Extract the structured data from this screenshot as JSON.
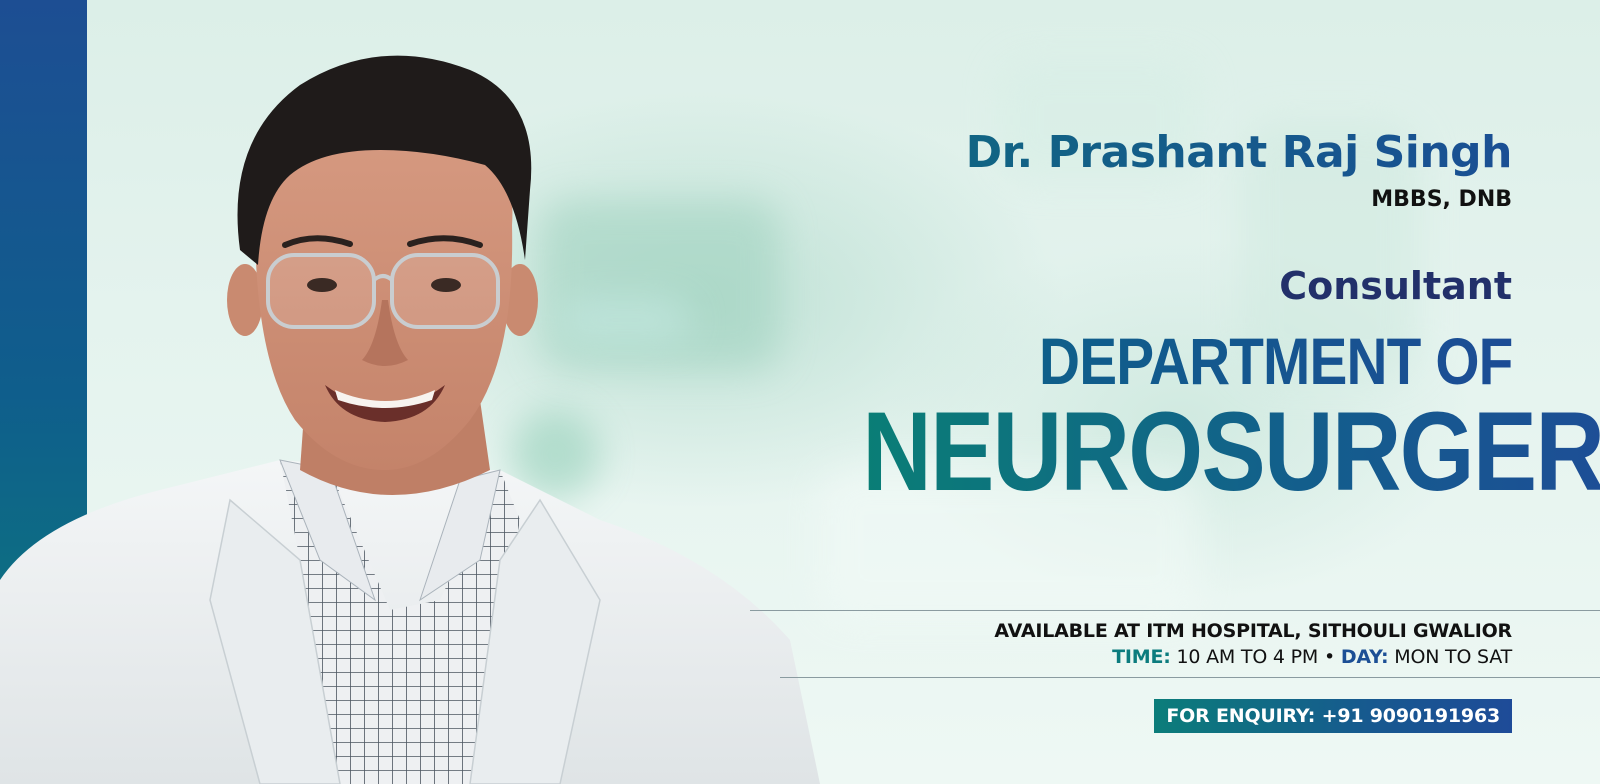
{
  "doctor": {
    "name": "Dr. Prashant Raj Singh",
    "degree": "MBBS, DNB",
    "role": "Consultant"
  },
  "department": {
    "line1": "DEPARTMENT OF",
    "line2": "NEUROSURGERY"
  },
  "availability": {
    "location": "AVAILABLE AT ITM HOSPITAL, SITHOULI GWALIOR",
    "time_label": "TIME:",
    "time_value": "10 AM TO 4 PM",
    "separator": "•",
    "day_label": "DAY:",
    "day_value": "MON TO SAT"
  },
  "enquiry": {
    "text": "FOR ENQUIRY: +91 9090191963"
  },
  "colors": {
    "brand_blue": "#1c4f95",
    "brand_teal": "#0b7d7a",
    "navy": "#22306a",
    "background_mint": "#e6f4ef"
  }
}
